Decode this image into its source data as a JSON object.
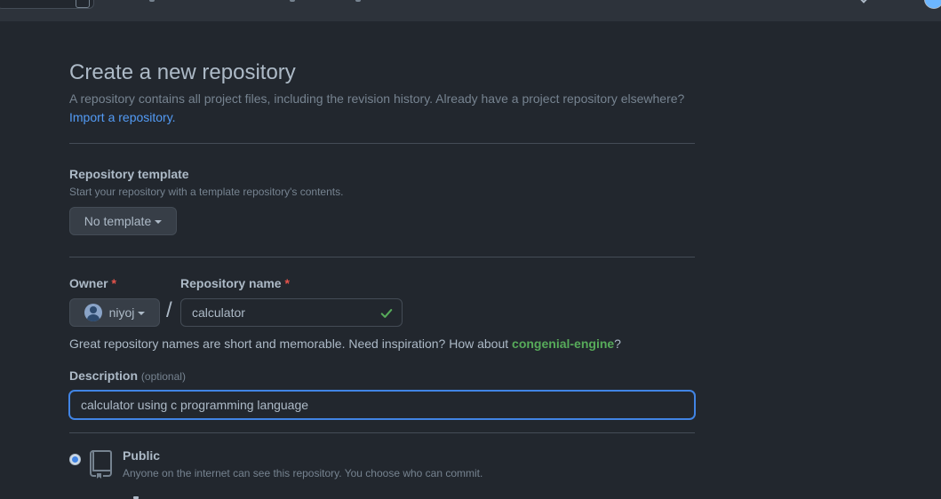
{
  "page": {
    "title": "Create a new repository",
    "subtitle": "A repository contains all project files, including the revision history. Already have a project repository elsewhere?",
    "import_link": "Import a repository."
  },
  "template": {
    "label": "Repository template",
    "note": "Start your repository with a template repository's contents.",
    "button_label": "No template"
  },
  "owner": {
    "label": "Owner",
    "required_mark": "*",
    "value": "niyoj"
  },
  "separator": "/",
  "repo_name": {
    "label": "Repository name",
    "required_mark": "*",
    "value": "calculator",
    "valid_icon": "check-icon"
  },
  "name_hint": {
    "prefix": "Great repository names are short and memorable. Need inspiration? How about",
    "suggestion": "congenial-engine",
    "suffix": "?"
  },
  "description": {
    "label": "Description",
    "optional_text": "(optional)",
    "value": "calculator using c programming language"
  },
  "visibility": {
    "public": {
      "label": "Public",
      "description": "Anyone on the internet can see this repository. You choose who can commit.",
      "selected": true,
      "icon": "repo-icon"
    }
  },
  "colors": {
    "background": "#22272e",
    "header": "#2d333b",
    "accent": "#539bf5",
    "success": "#57ab5a",
    "danger": "#e5534b"
  }
}
